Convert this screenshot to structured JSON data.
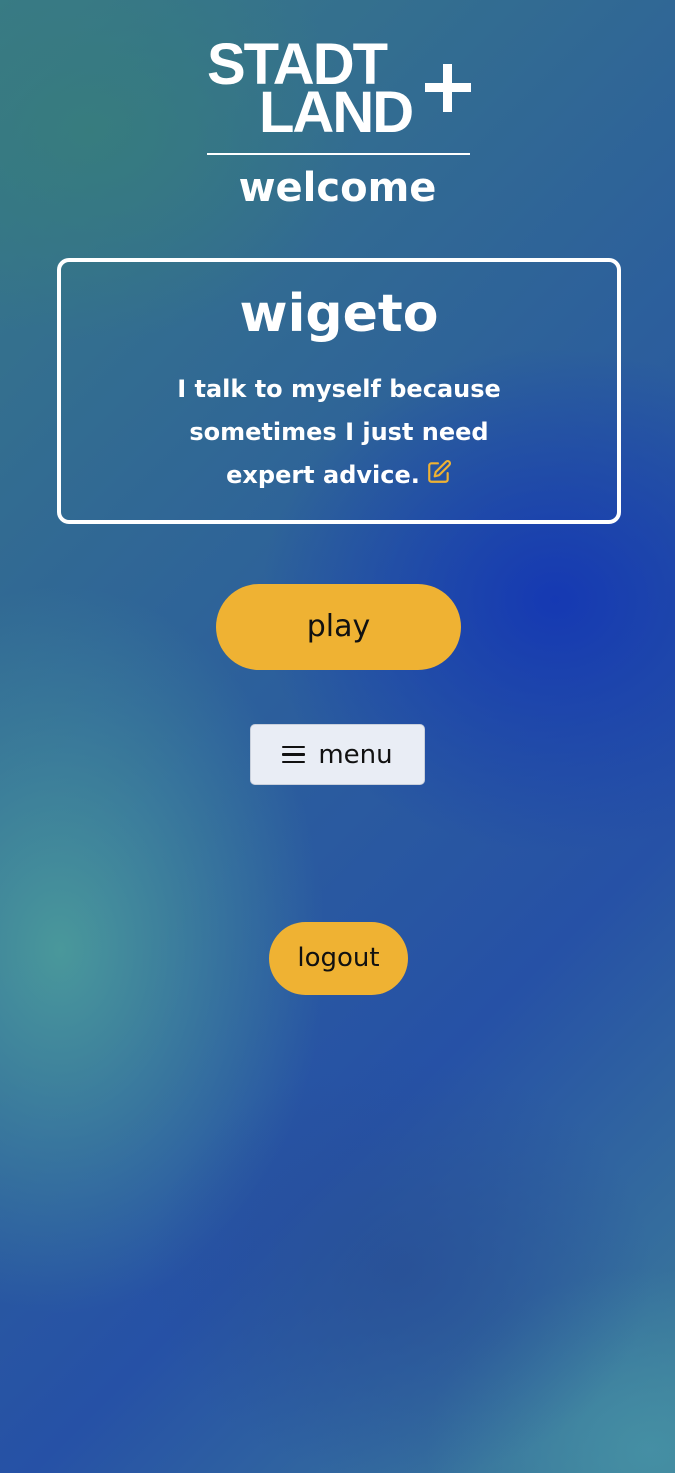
{
  "header": {
    "logo_line1": "STADT",
    "logo_line2": "LAND",
    "logo_symbol": "+",
    "welcome": "welcome"
  },
  "profile": {
    "username": "wigeto",
    "bio": "I talk to myself because sometimes I just need expert advice.",
    "edit_icon": "pencil-icon",
    "edit_icon_color": "#efb233"
  },
  "actions": {
    "play_label": "play",
    "menu_label": "menu",
    "menu_icon": "hamburger-icon",
    "logout_label": "logout"
  },
  "colors": {
    "accent": "#efb233",
    "menu_button_bg": "#e9edf5",
    "text": "#ffffff"
  }
}
